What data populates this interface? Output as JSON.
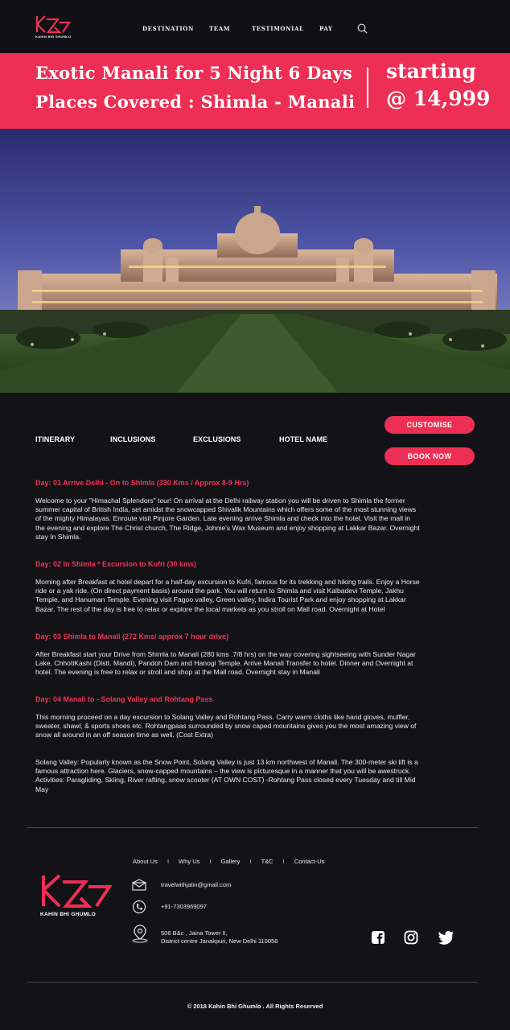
{
  "header": {
    "brand_small": "KAHIN BHI GHUMLO",
    "nav": [
      "DESTINATION",
      "TEAM",
      "TESTIMONIAL",
      "PAY"
    ]
  },
  "banner": {
    "title_line1": "Exotic Manali for 5 Night 6 Days",
    "title_line2": "Places Covered : Shimla - Manali",
    "price_line1": "starting",
    "price_line2": "@ 14,999",
    "color": "#ee2f55"
  },
  "tabs": [
    "ITINERARY",
    "INCLUSIONS",
    "EXCLUSIONS",
    "HOTEL NAME"
  ],
  "buttons": {
    "customise": "CUSTOMISE",
    "book_now": "BOOK NOW"
  },
  "itinerary": [
    {
      "title": "Day: 01 Arrive Delhi - On to Shimla (330 Kms / Approx 8-9 Hrs)",
      "text": "Welcome to your \"Himachal Splendors\" tour! On arrival at the Delhi railway station you will be driven to Shimla the former summer capital of British India, set amidst the snowcapped Shivalik Mountains which offers some of the most stunning views of the mighty Himalayas. Enroute visit Pinjore Garden. Late evening arrive Shimla and check into the hotel. Visit the mall in the evening and explore The Christ church, The Ridge, Johnie's Wax Museum and enjoy shopping at Lakkar Bazar. Overnight stay In Shimla."
    },
    {
      "title": "Day: 02 In Shimla * Excursion to Kufri (30 kms)",
      "text": "Morning after Breakfast at hotel depart for a half-day excursion to Kufri, famous for its trekking and hiking trails. Enjoy a Horse ride or a yak ride. (On direct payment basis) around the park. You will return to Shimla and visit Kalbadevi Temple, Jakhu Temple, and Hanuman Temple. Evening visit Fagoo valley, Green valley, Indira Tourist Park and enjoy shopping at Lakkar Bazar.  The rest of the day is free to relax or explore the local markets as you stroll on Mall road. Overnight at Hotel"
    },
    {
      "title": "Day: 03 Shimla to Manali (272 Kms/ approx 7 hour drive)",
      "text": "After Breakfast start your Drive from Shimla to Manali (280 kms .7/8 hrs) on the way covering sightseeing with Sunder Nagar Lake, ChhotiKashi (Distt. Mandi), Pandoh Dam and Hanogi Temple. Arrive Manali Transfer to hotel. Dinner and Overnight at hotel.   The evening is free to relax or stroll and shop at the Mall road. Overnight stay in Manali"
    },
    {
      "title": "Day: 04 Manali to - Solang Valley and Rohtang Pass",
      "text": "This morning proceed on a day excursion to Solang Valley and Rohtang Pass. Carry warm cloths like hand gloves, muffler, sweater, shawl, & sports shoes etc. Rohtangpaas surrounded by snow caped mountains gives you the most amazing view of snow all around in an off season time as well. (Cost Extra)",
      "text2": "Solang Valley: Popularly known as the Snow Point, Solang Valley is just 13 km northwest of Manali. The 300-meter ski lift is a famous attraction here. Glaciers, snow-capped mountains – the view is picturesque in a manner that you will be awestruck. Activities: Paragliding, Skiing, River rafting, snow scooter (AT OWN COST) -Rohtang Pass closed every Tuesday and till Mid May"
    }
  ],
  "footer": {
    "links": [
      "About Us",
      "Why Us",
      "Gallery",
      "T&C",
      "Contact-Us"
    ],
    "separator": "I",
    "brand": "KAHIN BHI GHUMLO",
    "email": "travelwithjatin@gmail.com",
    "phone": "+91-7303969097",
    "address_line1": "506 B&c , Jaina Tower II,",
    "address_line2": "District centre Janakpuri, New Delhi 110058",
    "social": [
      "facebook-icon",
      "instagram-icon",
      "twitter-icon"
    ],
    "copyright": "© 2018 Kahin Bhi Ghumlo . All Rights Reserved"
  }
}
